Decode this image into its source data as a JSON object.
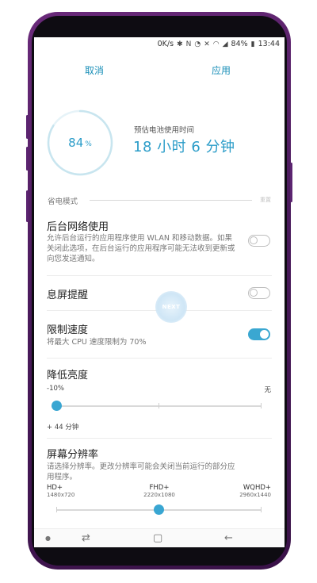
{
  "status_bar": {
    "network_speed": "0K/s",
    "battery": "84%",
    "time": "13:44",
    "icons": [
      "bluetooth-icon",
      "nfc-icon",
      "alarm-icon",
      "mute-icon",
      "wifi-icon",
      "signal-icon",
      "battery-icon"
    ]
  },
  "header": {
    "cancel": "取消",
    "apply": "应用"
  },
  "battery": {
    "percent": "84",
    "percent_unit": "%",
    "estimate_label": "预估电池使用时间",
    "estimate_value": "18 小时 6 分钟",
    "level": 0.84
  },
  "section": {
    "title": "省电模式",
    "extra": "重置"
  },
  "settings": {
    "background_network": {
      "title": "后台网络使用",
      "desc": "允许后台运行的应用程序使用 WLAN 和移动数据。如果关闭此选项，在后台运行的应用程序可能无法收到更新或向您发送通知。",
      "enabled": false
    },
    "aod": {
      "title": "息屏提醒",
      "enabled": false
    },
    "limit_speed": {
      "title": "限制速度",
      "desc": "将最大 CPU 速度限制为 70%",
      "enabled": true
    },
    "brightness": {
      "title": "降低亮度",
      "min_label": "-10%",
      "max_label": "无",
      "extra": "+ 44 分钟",
      "level": 0
    },
    "resolution": {
      "title": "屏幕分辨率",
      "desc": "请选择分辨率。更改分辨率可能会关闭当前运行的部分应用程序。",
      "options": [
        {
          "name": "HD+",
          "size": "1480x720"
        },
        {
          "name": "FHD+",
          "size": "2220x1080"
        },
        {
          "name": "WQHD+",
          "size": "2960x1440"
        }
      ],
      "selected_index": 1
    }
  },
  "overlay": {
    "next_label": "NEXT"
  },
  "navbar": {
    "icons": [
      "dot-icon",
      "recent-apps-icon",
      "home-icon",
      "back-icon"
    ]
  },
  "colors": {
    "accent": "#3aa7d1",
    "phone": "#5b2470"
  }
}
